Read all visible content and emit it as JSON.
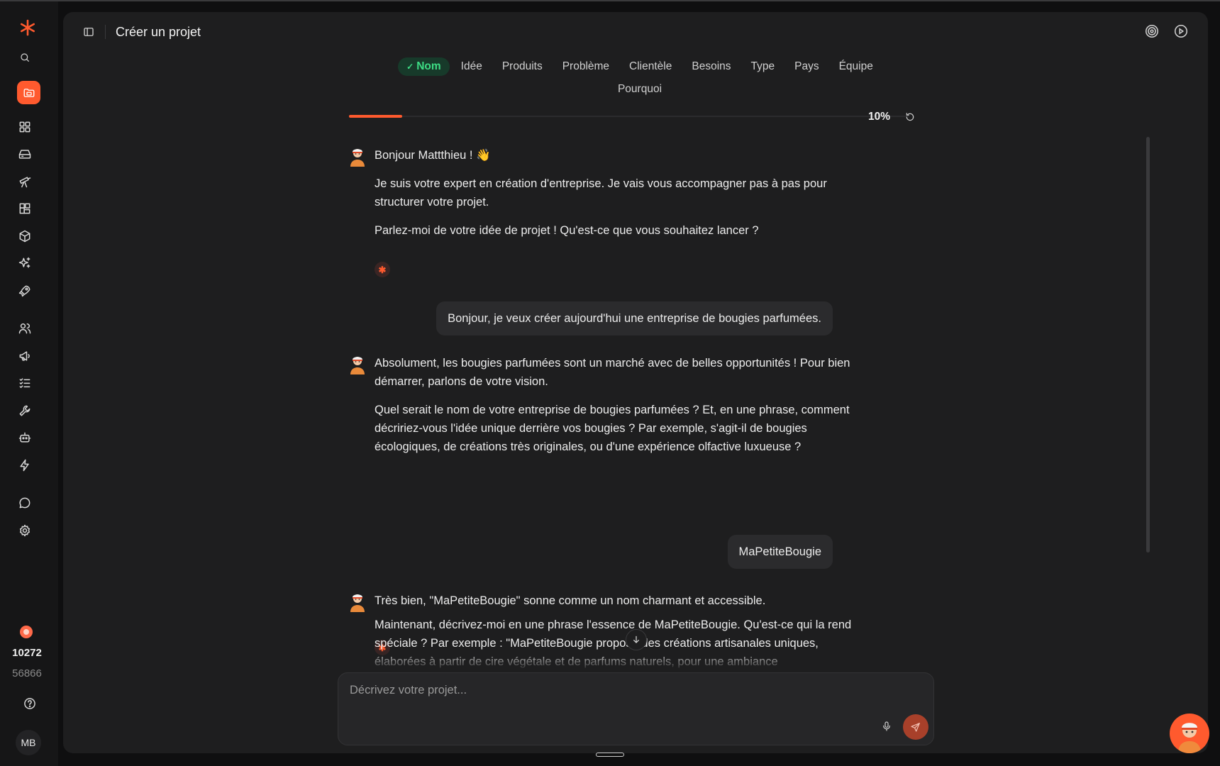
{
  "header": {
    "title": "Créer un projet"
  },
  "sidebar": {
    "icons": [
      "logo-icon",
      "search-icon",
      "projects-icon",
      "dashboard-icon",
      "inbox-icon",
      "telescope-icon",
      "widgets-icon",
      "package-icon",
      "sparkles-icon",
      "rocket-icon",
      "users-icon",
      "megaphone-icon",
      "checklist-icon",
      "wrench-icon",
      "bot-icon",
      "lightning-icon",
      "chat-icon",
      "settings-icon",
      "help-icon"
    ],
    "credits_primary": "10272",
    "credits_secondary": "56866",
    "user_initials": "MB"
  },
  "tabs": [
    {
      "label": "Nom",
      "active": true,
      "check": "✓"
    },
    {
      "label": "Idée",
      "active": false
    },
    {
      "label": "Produits",
      "active": false
    },
    {
      "label": "Problème",
      "active": false
    },
    {
      "label": "Clientèle",
      "active": false
    },
    {
      "label": "Besoins",
      "active": false
    },
    {
      "label": "Type",
      "active": false
    },
    {
      "label": "Pays",
      "active": false
    },
    {
      "label": "Équipe",
      "active": false
    },
    {
      "label": "Pourquoi",
      "active": false
    }
  ],
  "progress": {
    "value": 0.1,
    "label": "10%"
  },
  "messages": {
    "m1": {
      "p1": "Bonjour Mattthieu ! 👋",
      "p2": "Je suis votre expert en création d'entreprise. Je vais vous accompagner pas à pas pour structurer votre projet.",
      "p3": "Parlez-moi de votre idée de projet ! Qu'est-ce que vous souhaitez lancer ?"
    },
    "u1": "Bonjour, je veux créer aujourd'hui une entreprise de bougies parfumées.",
    "m2": {
      "p1": "Absolument, les bougies parfumées sont un marché avec de belles opportunités ! Pour bien démarrer, parlons de votre vision.",
      "p2": "Quel serait le nom de votre entreprise de bougies parfumées ? Et, en une phrase, comment décririez-vous l'idée unique derrière vos bougies ? Par exemple, s'agit-il de bougies écologiques, de créations très originales, ou d'une expérience olfactive luxueuse ?"
    },
    "u2": "MaPetiteBougie",
    "m3": {
      "p1": "Très bien, \"MaPetiteBougie\" sonne comme un nom charmant et accessible.",
      "p2": "Maintenant, décrivez-moi en une phrase l'essence de MaPetiteBougie. Qu'est-ce qui la rend spéciale ? Par exemple : \"MaPetiteBougie propose des créations artisanales uniques, élaborées à partir de cire végétale et de parfums naturels, pour une ambiance"
    }
  },
  "composer": {
    "placeholder": "Décrivez votre projet..."
  },
  "colors": {
    "accent": "#ff5a2e",
    "success": "#3ddc84",
    "background": "#1e1e1f"
  }
}
